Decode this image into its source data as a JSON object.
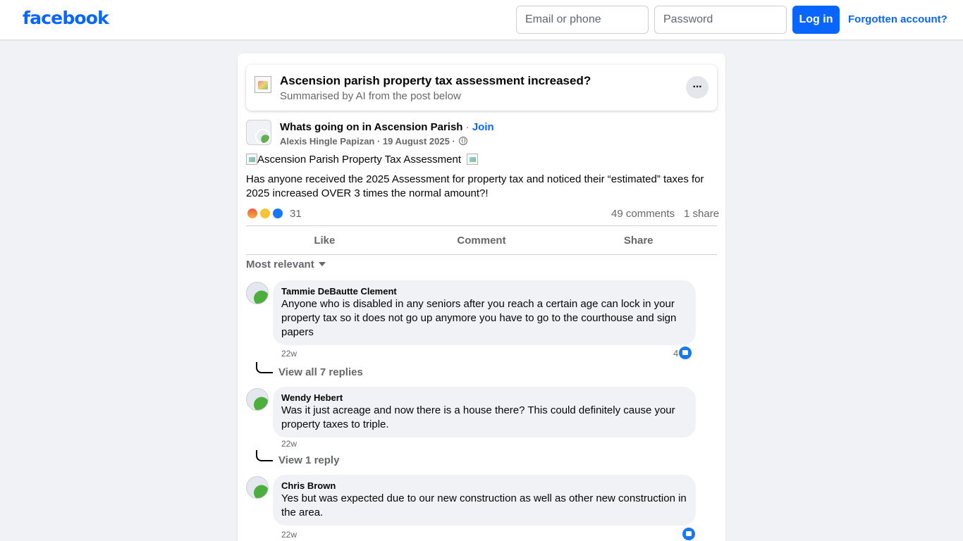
{
  "header": {
    "logo": "facebook",
    "email_placeholder": "Email or phone",
    "password_placeholder": "Password",
    "login_label": "Log in",
    "forgot_label": "Forgotten account?"
  },
  "ai_summary": {
    "title": "Ascension parish property tax assessment increased?",
    "subtitle": "Summarised by AI from the post below",
    "more_label": "···"
  },
  "post": {
    "group_name": "Whats going on in Ascension Parish",
    "separator": " · ",
    "join_label": "Join",
    "meta": "Alexis Hingle Papizan · 19 August 2025 · ",
    "image_alt": "Ascension Parish Property Tax Assessment",
    "text": "Has anyone received the 2025 Assessment for property tax and noticed their “estimated” taxes for 2025 increased OVER 3 times the normal amount?!",
    "reaction_count": "31",
    "comments_count": "49 comments",
    "shares_count": "1 share"
  },
  "actions": {
    "like": "Like",
    "comment": "Comment",
    "share": "Share"
  },
  "sort_label": "Most relevant",
  "comments": [
    {
      "author": "Tammie DeBautte Clement",
      "text": "Anyone who is disabled in any seniors after you reach a certain age can lock in your property tax so it does not go up anymore you have to go to the courthouse and sign papers",
      "time": "22w",
      "likes": "4",
      "replies_label": "View all 7 replies"
    },
    {
      "author": "Wendy Hebert",
      "text": "Was it just acreage and now there is a house there? This could definitely cause your property taxes to triple.",
      "time": "22w",
      "likes": "",
      "replies_label": "View 1 reply"
    },
    {
      "author": "Chris Brown",
      "text": "Yes but was expected due to our new construction as well as other new construction in the area.",
      "time": "22w",
      "likes": ""
    }
  ],
  "colors": {
    "brand": "#0866ff",
    "background": "#f0f2f5",
    "secondary_text": "#65676b",
    "like_blue": "#1877f2"
  }
}
